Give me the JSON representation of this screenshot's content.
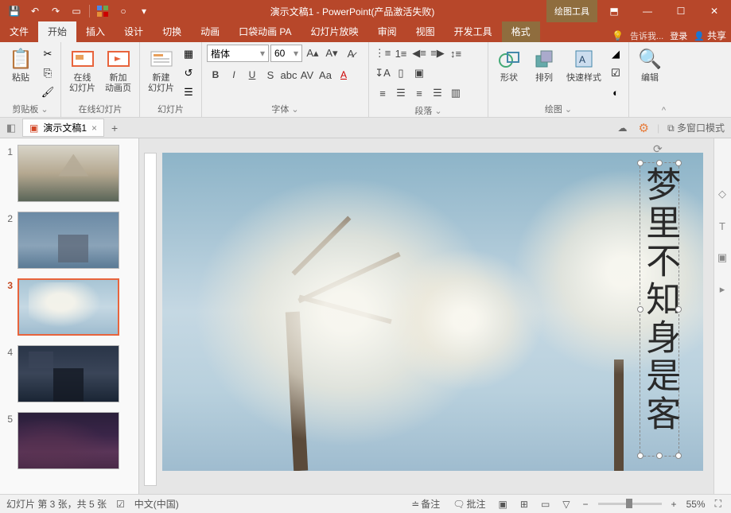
{
  "title": "演示文稿1 - PowerPoint(产品激活失败)",
  "contextTool": "绘图工具",
  "menu": {
    "file": "文件",
    "home": "开始",
    "insert": "插入",
    "design": "设计",
    "transition": "切换",
    "animation": "动画",
    "pocket": "口袋动画 PA",
    "slideshow": "幻灯片放映",
    "review": "审阅",
    "view": "视图",
    "developer": "开发工具",
    "format": "格式",
    "tellme": "告诉我...",
    "login": "登录",
    "share": "共享"
  },
  "ribbon": {
    "paste": "粘贴",
    "clipboard": "剪贴板",
    "onlineSlide": "在线\n幻灯片",
    "newAnim": "新加\n动画页",
    "onlineSlideGroup": "在线幻灯片",
    "newSlide": "新建\n幻灯片",
    "slidesGroup": "幻灯片",
    "fontName": "楷体",
    "fontSize": "60",
    "fontGroup": "字体",
    "paragraphGroup": "段落",
    "shape": "形状",
    "arrange": "排列",
    "quickStyle": "快速样式",
    "drawGroup": "绘图",
    "edit": "编辑"
  },
  "doc": {
    "tabName": "演示文稿1",
    "multiWindow": "多窗口模式"
  },
  "slides": [
    {
      "num": "1"
    },
    {
      "num": "2"
    },
    {
      "num": "3"
    },
    {
      "num": "4"
    },
    {
      "num": "5"
    }
  ],
  "slideText": "梦里不知身是客",
  "status": {
    "slideInfo": "幻灯片 第 3 张，共 5 张",
    "lang": "中文(中国)",
    "notes": "备注",
    "comments": "批注",
    "zoom": "55%"
  }
}
